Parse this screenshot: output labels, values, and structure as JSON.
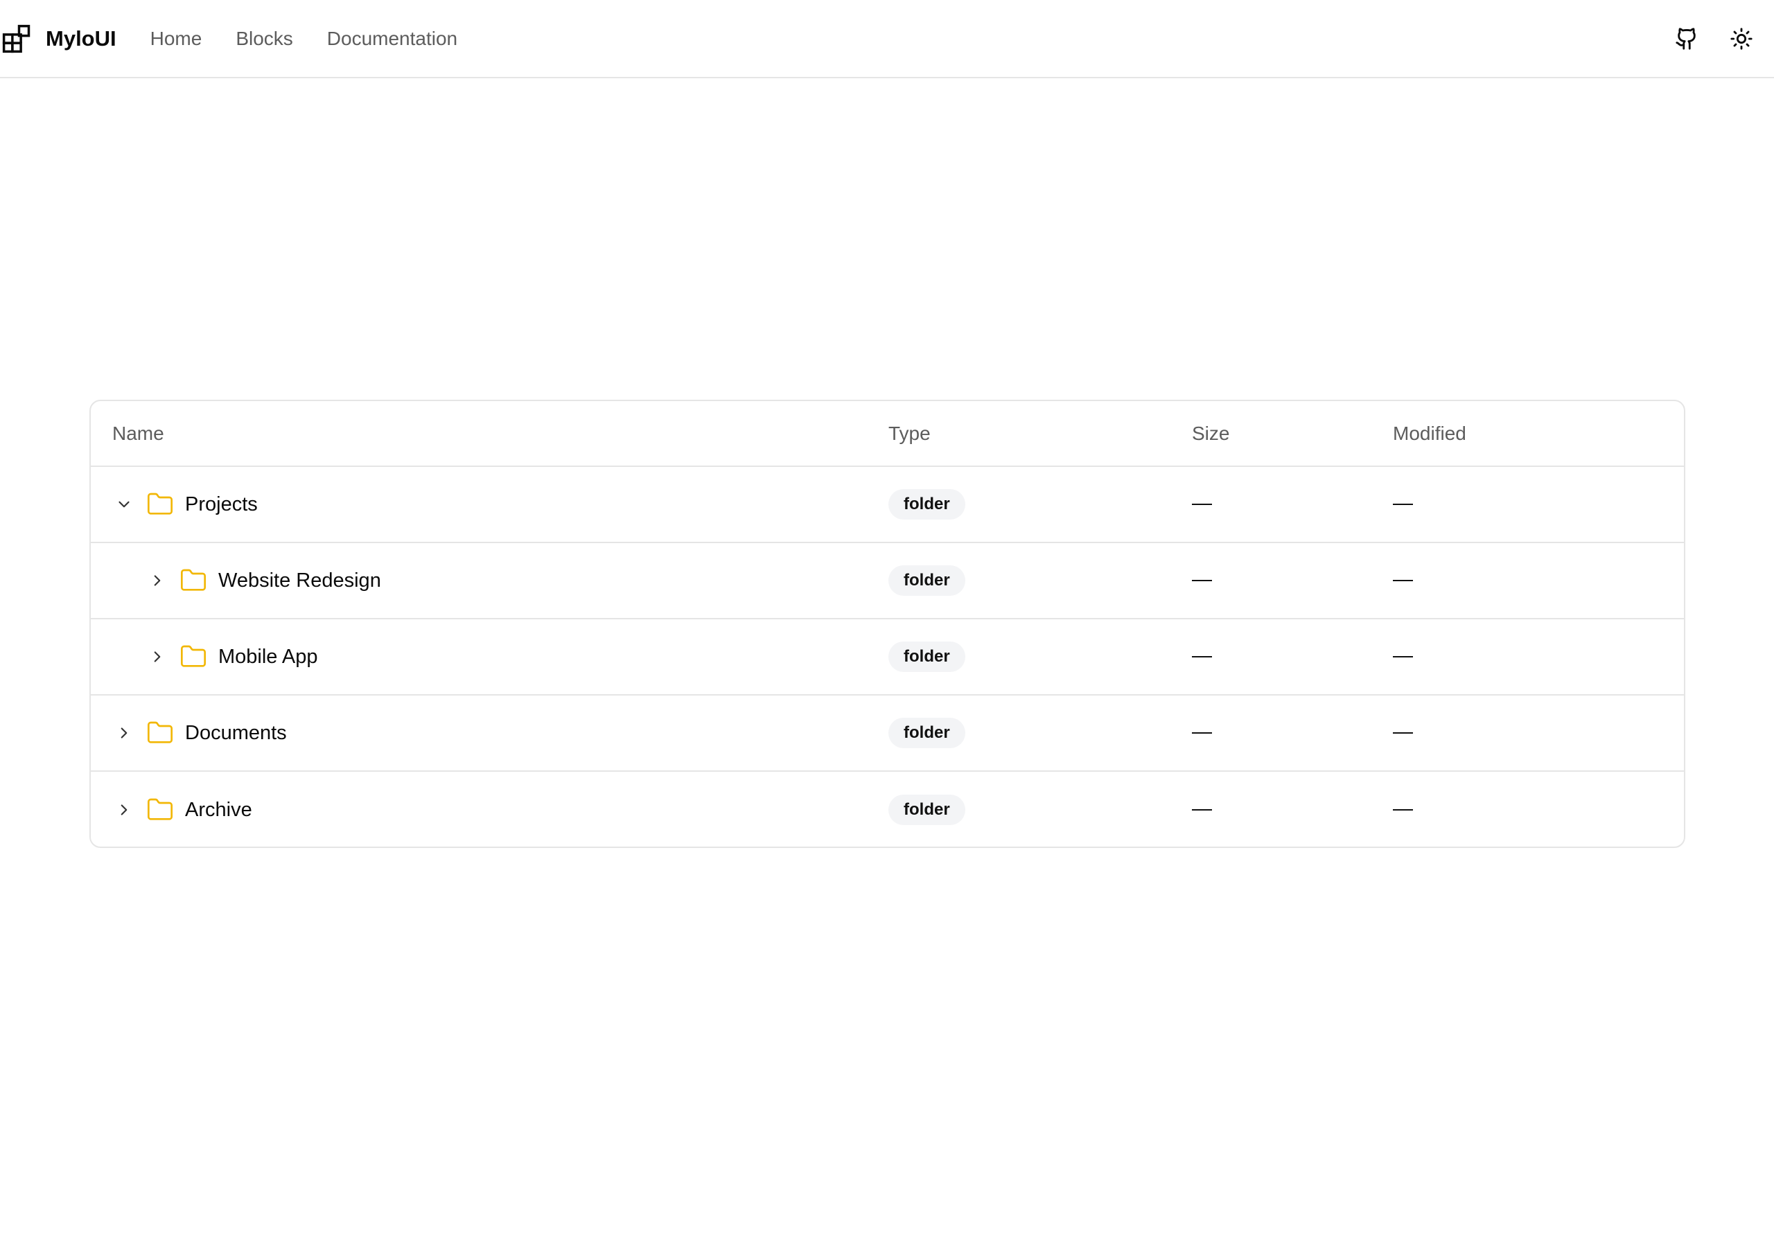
{
  "app": {
    "name": "MyloUI",
    "logo_icon": "blocks-logo-icon"
  },
  "nav": {
    "items": [
      {
        "label": "Home"
      },
      {
        "label": "Blocks"
      },
      {
        "label": "Documentation"
      }
    ]
  },
  "top_actions": {
    "github_icon": "github-icon",
    "theme_icon": "sun-icon"
  },
  "colors": {
    "folder": "#f2b705",
    "border": "#e5e5e5",
    "badge_bg": "#f3f4f6",
    "muted_text": "#5c5c5c"
  },
  "table": {
    "columns": [
      "Name",
      "Type",
      "Size",
      "Modified"
    ],
    "rows": [
      {
        "name": "Projects",
        "type": "folder",
        "size": "—",
        "modified": "—",
        "depth": 0,
        "expanded": true
      },
      {
        "name": "Website Redesign",
        "type": "folder",
        "size": "—",
        "modified": "—",
        "depth": 1,
        "expanded": false
      },
      {
        "name": "Mobile App",
        "type": "folder",
        "size": "—",
        "modified": "—",
        "depth": 1,
        "expanded": false
      },
      {
        "name": "Documents",
        "type": "folder",
        "size": "—",
        "modified": "—",
        "depth": 0,
        "expanded": false
      },
      {
        "name": "Archive",
        "type": "folder",
        "size": "—",
        "modified": "—",
        "depth": 0,
        "expanded": false
      }
    ]
  }
}
